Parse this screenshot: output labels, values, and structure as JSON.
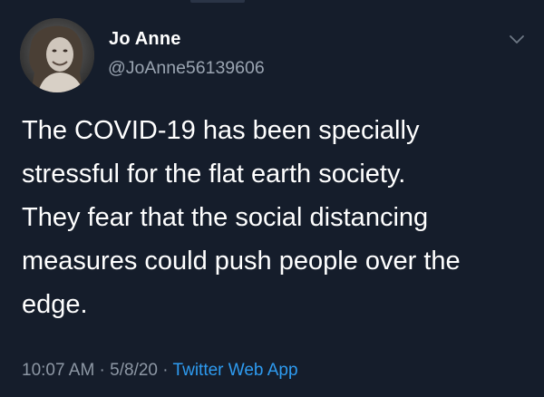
{
  "tweet": {
    "author": {
      "display_name": "Jo Anne",
      "handle": "@JoAnne56139606",
      "avatar_icon": "profile-photo"
    },
    "text_lines": [
      "The COVID-19 has been specially",
      "stressful for the flat earth society.",
      "They fear that the social distancing",
      "measures could push people over the",
      "edge."
    ],
    "meta": {
      "time": "10:07 AM",
      "separator": " · ",
      "date": "5/8/20",
      "source": "Twitter Web App"
    },
    "more_icon": "chevron-down-icon"
  },
  "colors": {
    "background": "#151d2b",
    "text": "#ffffff",
    "secondary_text": "#9aa4b1",
    "link": "#2e9bf0"
  }
}
